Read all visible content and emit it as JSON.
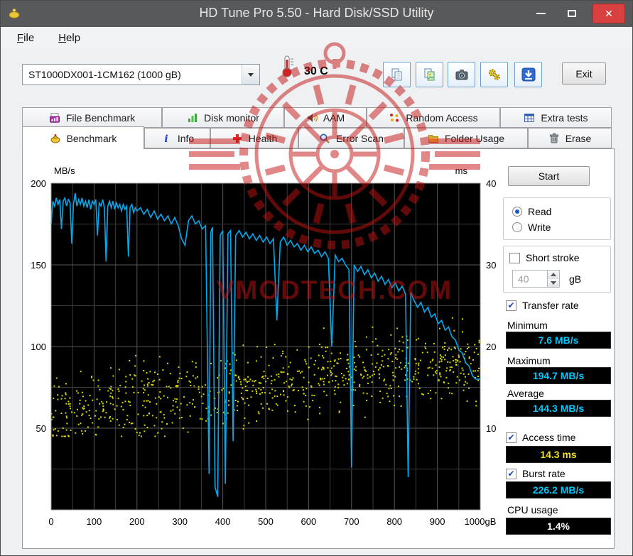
{
  "window": {
    "title": "HD Tune Pro 5.50 - Hard Disk/SSD Utility",
    "close_glyph": "✕"
  },
  "menu": {
    "file_label": "File",
    "help_label": "Help"
  },
  "toolbar": {
    "drive": "ST1000DX001-1CM162 (1000 gB)",
    "temperature": "30 C",
    "exit_label": "Exit"
  },
  "tabs": {
    "active": "Benchmark",
    "row1": [
      {
        "label": "File Benchmark"
      },
      {
        "label": "Disk monitor"
      },
      {
        "label": "AAM"
      },
      {
        "label": "Random Access"
      },
      {
        "label": "Extra tests"
      }
    ],
    "row2": [
      {
        "label": "Benchmark"
      },
      {
        "label": "Info"
      },
      {
        "label": "Health"
      },
      {
        "label": "Error Scan"
      },
      {
        "label": "Folder Usage"
      },
      {
        "label": "Erase"
      }
    ]
  },
  "panel": {
    "start_label": "Start",
    "read_label": "Read",
    "write_label": "Write",
    "short_stroke_label": "Short stroke",
    "short_stroke_value": "40",
    "short_stroke_unit": "gB",
    "transfer_rate_label": "Transfer rate",
    "minimum_label": "Minimum",
    "minimum_value": "7.6 MB/s",
    "maximum_label": "Maximum",
    "maximum_value": "194.7 MB/s",
    "average_label": "Average",
    "average_value": "144.3 MB/s",
    "access_time_label": "Access time",
    "access_time_value": "14.3 ms",
    "burst_rate_label": "Burst rate",
    "burst_rate_value": "226.2 MB/s",
    "cpu_usage_label": "CPU usage",
    "cpu_usage_value": "1.4%"
  },
  "watermark": {
    "text": "VMODTECH.COM",
    "color": "#c41212"
  },
  "chart_data": {
    "type": "line+scatter",
    "x_axis": {
      "min": 0,
      "max": 1000,
      "tick_step": 100,
      "tick_labels": [
        "0",
        "100",
        "200",
        "300",
        "400",
        "500",
        "600",
        "700",
        "800",
        "900",
        "1000gB"
      ]
    },
    "left_axis": {
      "label": "MB/s",
      "min": 0,
      "max": 200,
      "ticks": [
        200,
        150,
        100,
        50
      ]
    },
    "right_axis": {
      "label": "ms",
      "min": 0,
      "max": 40,
      "ticks": [
        40,
        30,
        20,
        10
      ]
    },
    "grid": {
      "x_minor": 50,
      "y_minor": 25
    },
    "series": [
      {
        "name": "Transfer rate",
        "type": "line",
        "unit": "MB/s",
        "color": "#00aaee",
        "points": [
          [
            0,
            175
          ],
          [
            4,
            189
          ],
          [
            8,
            186
          ],
          [
            12,
            191
          ],
          [
            16,
            187
          ],
          [
            20,
            190
          ],
          [
            24,
            172
          ],
          [
            28,
            189
          ],
          [
            32,
            191
          ],
          [
            36,
            186
          ],
          [
            40,
            190
          ],
          [
            44,
            188
          ],
          [
            48,
            163
          ],
          [
            52,
            187
          ],
          [
            56,
            194
          ],
          [
            60,
            186
          ],
          [
            64,
            190
          ],
          [
            68,
            187
          ],
          [
            72,
            191
          ],
          [
            76,
            186
          ],
          [
            80,
            189
          ],
          [
            84,
            185
          ],
          [
            88,
            190
          ],
          [
            92,
            184
          ],
          [
            96,
            189
          ],
          [
            100,
            187
          ],
          [
            104,
            190
          ],
          [
            108,
            168
          ],
          [
            112,
            188
          ],
          [
            116,
            186
          ],
          [
            120,
            190
          ],
          [
            124,
            185
          ],
          [
            128,
            152
          ],
          [
            132,
            186
          ],
          [
            136,
            189
          ],
          [
            140,
            185
          ],
          [
            144,
            189
          ],
          [
            148,
            184
          ],
          [
            152,
            188
          ],
          [
            156,
            185
          ],
          [
            160,
            187
          ],
          [
            164,
            183
          ],
          [
            168,
            187
          ],
          [
            172,
            184
          ],
          [
            176,
            186
          ],
          [
            180,
            155
          ],
          [
            184,
            185
          ],
          [
            188,
            187
          ],
          [
            192,
            182
          ],
          [
            196,
            185
          ],
          [
            200,
            183
          ],
          [
            208,
            185
          ],
          [
            216,
            181
          ],
          [
            224,
            184
          ],
          [
            232,
            179
          ],
          [
            240,
            183
          ],
          [
            248,
            178
          ],
          [
            256,
            181
          ],
          [
            264,
            177
          ],
          [
            272,
            180
          ],
          [
            280,
            175
          ],
          [
            288,
            179
          ],
          [
            296,
            174
          ],
          [
            304,
            166
          ],
          [
            312,
            162
          ],
          [
            320,
            177
          ],
          [
            328,
            180
          ],
          [
            336,
            175
          ],
          [
            344,
            177
          ],
          [
            352,
            172
          ],
          [
            360,
            174
          ],
          [
            368,
            22
          ],
          [
            372,
            170
          ],
          [
            376,
            173
          ],
          [
            382,
            14
          ],
          [
            388,
            8
          ],
          [
            394,
            168
          ],
          [
            400,
            171
          ],
          [
            406,
            16
          ],
          [
            412,
            169
          ],
          [
            418,
            171
          ],
          [
            424,
            42
          ],
          [
            430,
            168
          ],
          [
            438,
            171
          ],
          [
            446,
            167
          ],
          [
            454,
            170
          ],
          [
            462,
            166
          ],
          [
            470,
            169
          ],
          [
            478,
            165
          ],
          [
            486,
            168
          ],
          [
            494,
            164
          ],
          [
            502,
            167
          ],
          [
            510,
            163
          ],
          [
            518,
            166
          ],
          [
            526,
            116
          ],
          [
            534,
            164
          ],
          [
            542,
            167
          ],
          [
            550,
            162
          ],
          [
            558,
            165
          ],
          [
            566,
            161
          ],
          [
            574,
            163
          ],
          [
            582,
            159
          ],
          [
            590,
            162
          ],
          [
            598,
            158
          ],
          [
            606,
            161
          ],
          [
            614,
            157
          ],
          [
            622,
            159
          ],
          [
            630,
            155
          ],
          [
            638,
            158
          ],
          [
            646,
            154
          ],
          [
            654,
            100
          ],
          [
            662,
            156
          ],
          [
            670,
            152
          ],
          [
            678,
            154
          ],
          [
            686,
            150
          ],
          [
            694,
            147
          ],
          [
            700,
            26
          ],
          [
            706,
            150
          ],
          [
            714,
            146
          ],
          [
            722,
            149
          ],
          [
            730,
            144
          ],
          [
            738,
            147
          ],
          [
            746,
            142
          ],
          [
            754,
            145
          ],
          [
            762,
            140
          ],
          [
            770,
            143
          ],
          [
            778,
            138
          ],
          [
            786,
            141
          ],
          [
            794,
            136
          ],
          [
            802,
            139
          ],
          [
            810,
            134
          ],
          [
            818,
            137
          ],
          [
            826,
            132
          ],
          [
            832,
            20
          ],
          [
            838,
            133
          ],
          [
            846,
            128
          ],
          [
            854,
            124
          ],
          [
            862,
            127
          ],
          [
            870,
            121
          ],
          [
            878,
            124
          ],
          [
            886,
            118
          ],
          [
            894,
            120
          ],
          [
            902,
            114
          ],
          [
            910,
            116
          ],
          [
            918,
            110
          ],
          [
            926,
            112
          ],
          [
            934,
            106
          ],
          [
            942,
            104
          ],
          [
            950,
            98
          ],
          [
            958,
            96
          ],
          [
            966,
            90
          ],
          [
            974,
            88
          ],
          [
            982,
            82
          ],
          [
            990,
            80
          ],
          [
            1000,
            80
          ]
        ]
      },
      {
        "name": "Access time",
        "type": "scatter",
        "unit": "ms",
        "color": "#d8d800",
        "generated": {
          "seed": 20140912,
          "count": 820,
          "trend_start_ms": 12,
          "trend_end_ms": 18.5,
          "spread_ms": 4.2,
          "min_ms": 9,
          "max_ms": 23.5
        }
      }
    ],
    "stats": {
      "minimum_mbs": 7.6,
      "maximum_mbs": 194.7,
      "average_mbs": 144.3,
      "access_time_ms": 14.3,
      "burst_rate_mbs": 226.2,
      "cpu_usage_pct": 1.4
    }
  }
}
